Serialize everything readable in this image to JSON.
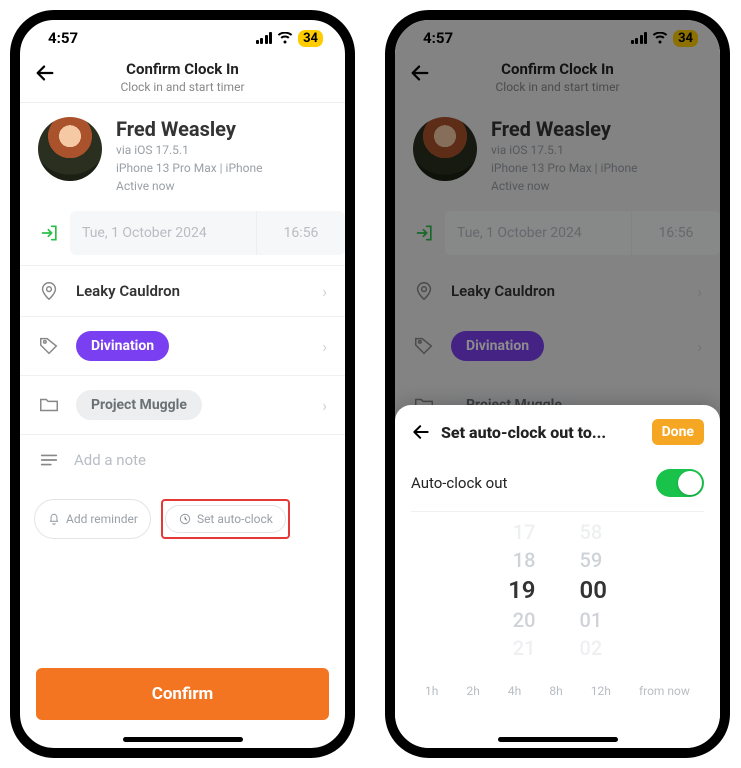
{
  "status": {
    "time": "4:57",
    "battery": "34"
  },
  "header": {
    "title": "Confirm Clock In",
    "subtitle": "Clock in and start timer"
  },
  "profile": {
    "name": "Fred Weasley",
    "via": "via iOS 17.5.1",
    "device": "iPhone 13 Pro Max | iPhone",
    "status": "Active now"
  },
  "datetime": {
    "date": "Tue, 1 October 2024",
    "time": "16:56"
  },
  "location": {
    "label": "Leaky Cauldron"
  },
  "tag": {
    "label": "Divination"
  },
  "project": {
    "label": "Project Muggle"
  },
  "note": {
    "placeholder": "Add a note"
  },
  "chips": {
    "reminder": "Add reminder",
    "autoclock": "Set auto-clock"
  },
  "confirm": "Confirm",
  "sheet": {
    "title": "Set auto-clock out to...",
    "done": "Done",
    "toggle_label": "Auto-clock out",
    "picker": {
      "rows": [
        {
          "h": "17",
          "m": "58"
        },
        {
          "h": "18",
          "m": "59"
        },
        {
          "h": "19",
          "m": "00"
        },
        {
          "h": "20",
          "m": "01"
        },
        {
          "h": "21",
          "m": "02"
        }
      ],
      "selected_index": 2
    },
    "quick": [
      "1h",
      "2h",
      "4h",
      "8h",
      "12h",
      "from now"
    ]
  }
}
